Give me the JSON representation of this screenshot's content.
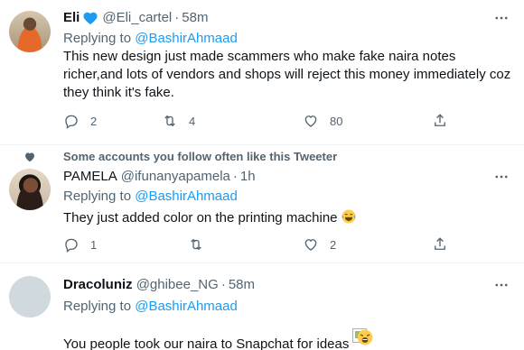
{
  "social_context": "Some accounts you follow often like this Tweeter",
  "tweets": [
    {
      "name": "Eli",
      "handle": "@Eli_cartel",
      "separator": "·",
      "time": "58m",
      "replying_prefix": "Replying to",
      "replying_to": "@BashirAhmaad",
      "text": "This new design just made scammers who make fake naira notes richer,and lots of vendors and shops will reject this money immediately coz they think it's fake.",
      "replies": "2",
      "retweets": "4",
      "likes": "80",
      "verified": true
    },
    {
      "name": "PAMELA",
      "handle": "@ifunanyapamela",
      "separator": "·",
      "time": "1h",
      "replying_prefix": "Replying to",
      "replying_to": "@BashirAhmaad",
      "text": "They just added color on the printing machine",
      "replies": "1",
      "retweets": "",
      "likes": "2"
    },
    {
      "name": "Dracoluniz",
      "handle": "@ghibee_NG",
      "separator": "·",
      "time": "58m",
      "replying_prefix": "Replying to",
      "replying_to": "@BashirAhmaad",
      "text": "You people took our naira to Snapchat for ideas"
    }
  ],
  "colors": {
    "accent": "#1d9bf0",
    "secondary_text": "#536471",
    "primary_text": "#0f1419",
    "divider": "#eff3f4"
  },
  "icons": [
    "verified-badge-icon",
    "more-icon",
    "reply-icon",
    "retweet-icon",
    "like-icon",
    "share-icon",
    "heart-icon",
    "tears-of-joy-emoji",
    "weary-emoji"
  ]
}
